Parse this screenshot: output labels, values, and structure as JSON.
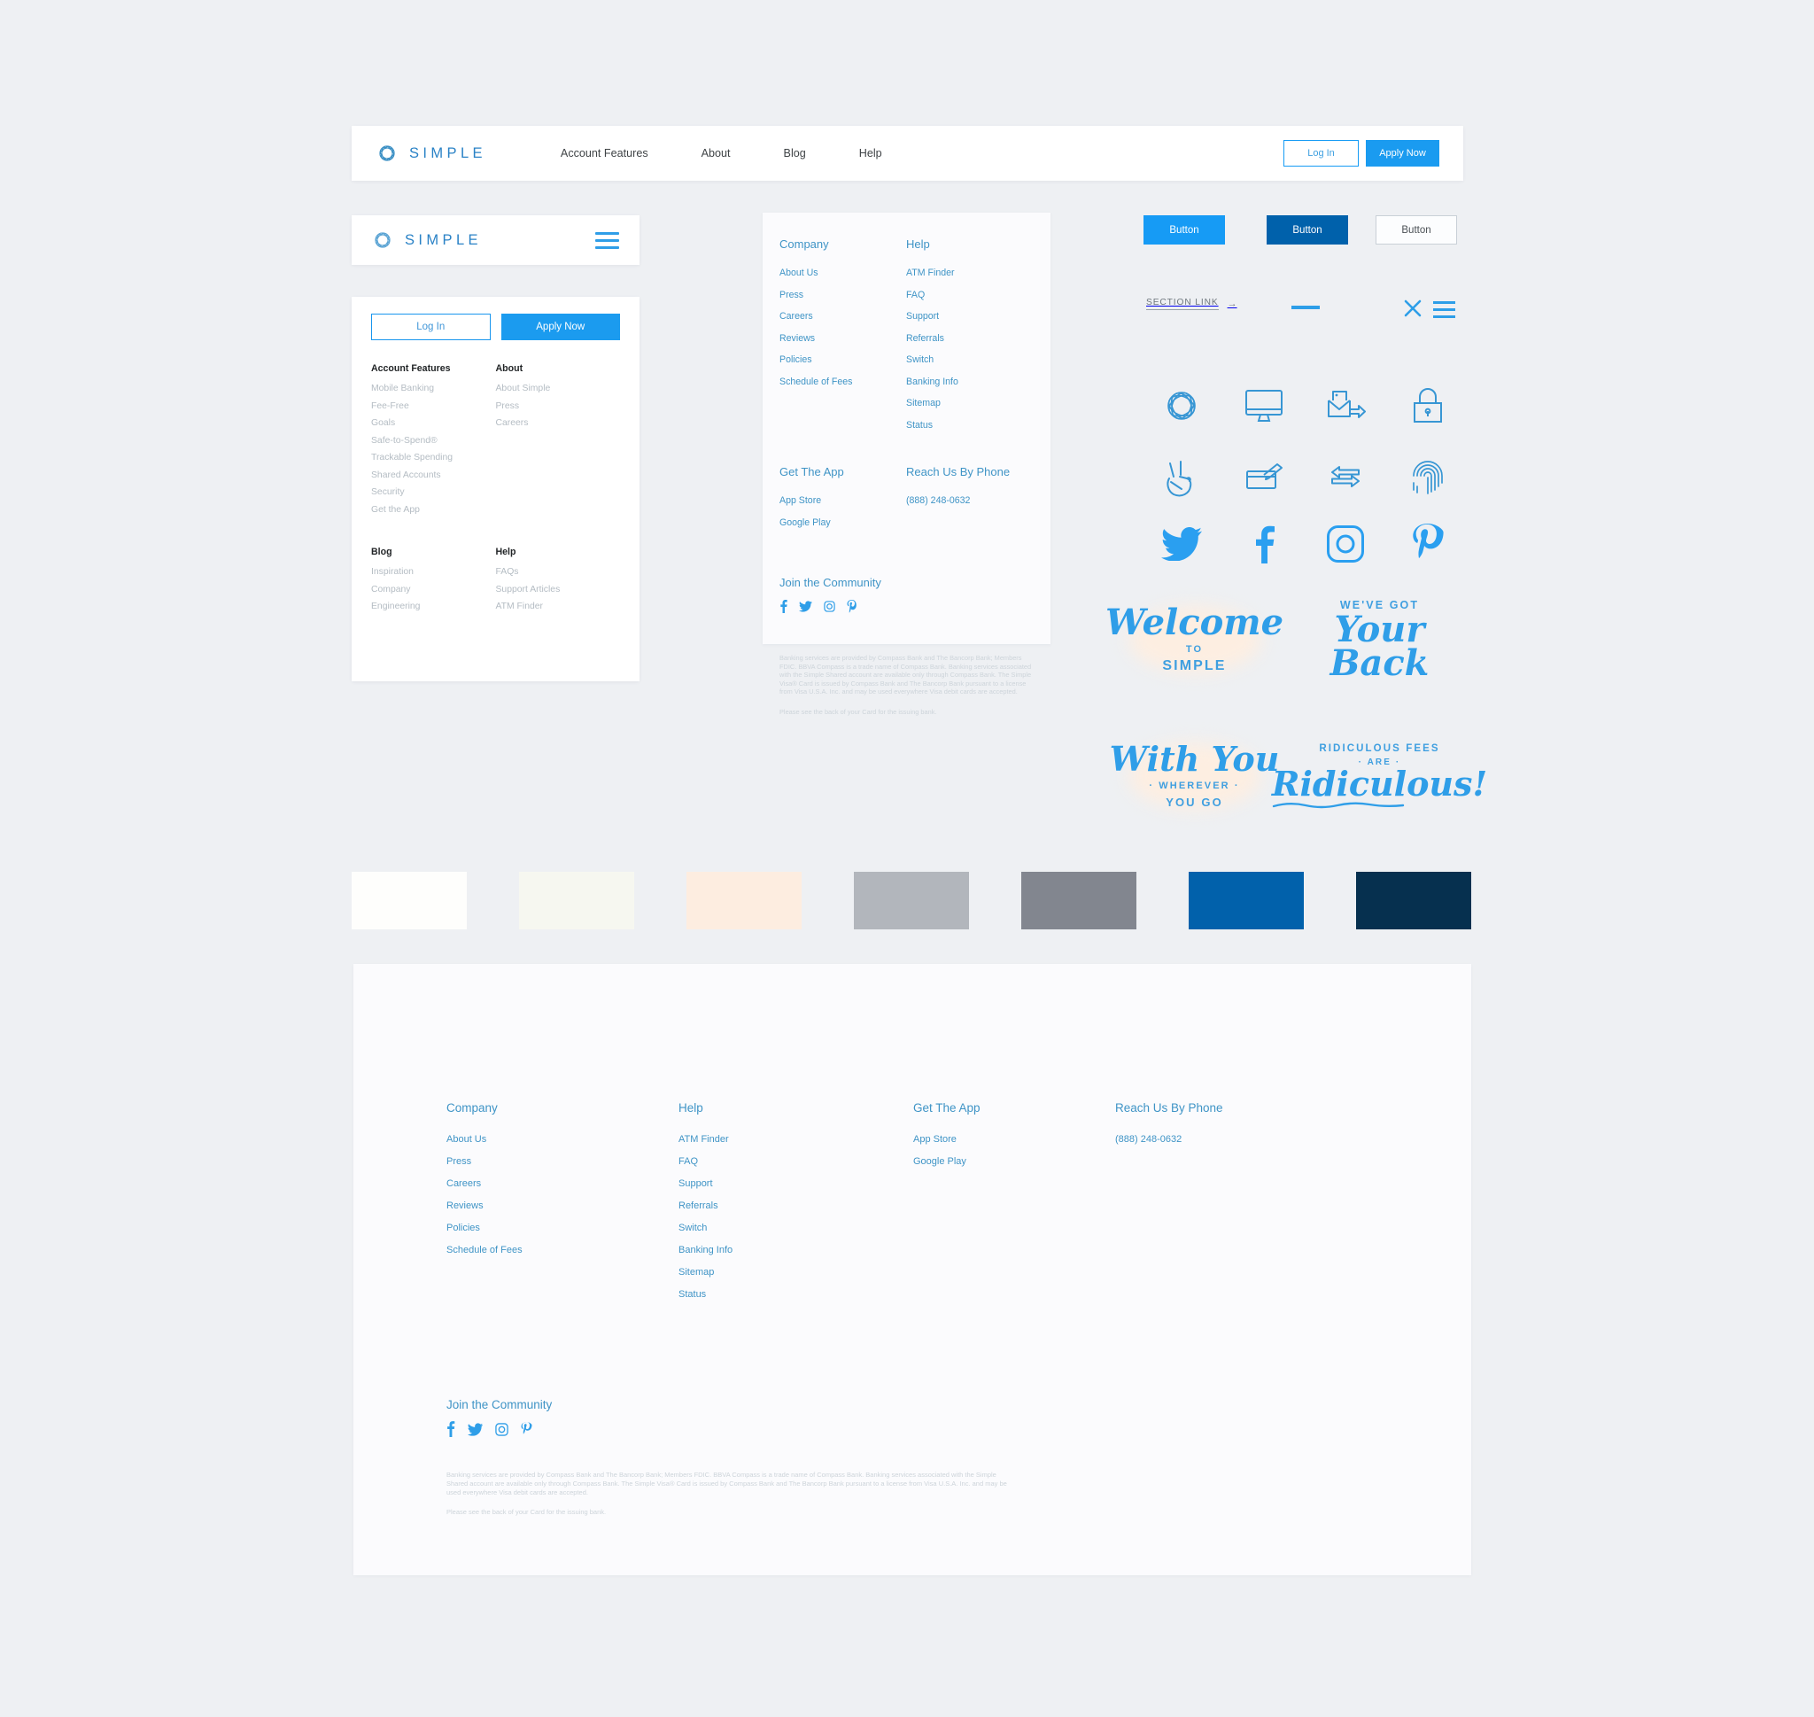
{
  "brand": {
    "name": "SIMPLE",
    "logo_icon": "simple-knot-logo-icon"
  },
  "topnav": {
    "links": [
      {
        "label": "Account Features"
      },
      {
        "label": "About"
      },
      {
        "label": "Blog"
      },
      {
        "label": "Help"
      }
    ],
    "login_label": "Log In",
    "apply_label": "Apply Now"
  },
  "mobile_menu": {
    "login_label": "Log In",
    "apply_label": "Apply Now",
    "menu_icon": "hamburger-icon",
    "columns_row1": [
      {
        "heading": "Account Features",
        "links": [
          "Mobile Banking",
          "Fee-Free",
          "Goals",
          "Safe-to-Spend®",
          "Trackable Spending",
          "Shared Accounts",
          "Security",
          "Get the App"
        ]
      },
      {
        "heading": "About",
        "links": [
          "About Simple",
          "Press",
          "Careers"
        ]
      }
    ],
    "columns_row2": [
      {
        "heading": "Blog",
        "links": [
          "Inspiration",
          "Company",
          "Engineering"
        ]
      },
      {
        "heading": "Help",
        "links": [
          "FAQs",
          "Support Articles",
          "ATM Finder"
        ]
      }
    ]
  },
  "footer_card": {
    "columns_row1": [
      {
        "heading": "Company",
        "links": [
          "About Us",
          "Press",
          "Careers",
          "Reviews",
          "Policies",
          "Schedule of Fees"
        ]
      },
      {
        "heading": "Help",
        "links": [
          "ATM Finder",
          "FAQ",
          "Support",
          "Referrals",
          "Switch",
          "Banking Info",
          "Sitemap",
          "Status"
        ]
      }
    ],
    "columns_row2": [
      {
        "heading": "Get The App",
        "links": [
          "App Store",
          "Google Play"
        ]
      },
      {
        "heading": "Reach Us By Phone",
        "links": [
          "(888) 248-0632"
        ]
      }
    ],
    "community_heading": "Join the Community",
    "social": [
      "facebook-icon",
      "twitter-icon",
      "instagram-icon",
      "pinterest-icon"
    ],
    "legal_1": "Banking services are provided by Compass Bank and The Bancorp Bank; Members FDIC. BBVA Compass is a trade name of Compass Bank. Banking services associated with the Simple Shared account are available only through Compass Bank. The Simple Visa® Card is issued by Compass Bank and The Bancorp Bank pursuant to a license from Visa U.S.A. Inc. and may be used everywhere Visa debit cards are accepted.",
    "legal_2": "Please see the back of your Card for the issuing bank."
  },
  "components": {
    "button_primary_label": "Button",
    "button_dark_label": "Button",
    "button_outline_label": "Button",
    "section_link_label": "SECTION LINK",
    "section_link_arrow": "→",
    "close_icon": "close-x-icon",
    "menu_icon": "hamburger-icon",
    "rule": "horizontal-rule-accent"
  },
  "icons": {
    "row1": [
      "simple-knot-logo-icon",
      "desktop-monitor-icon",
      "envelope-send-icon",
      "padlock-icon"
    ],
    "row2": [
      "peace-hand-icon",
      "card-swipe-icon",
      "transfer-arrows-icon",
      "fingerprint-icon"
    ],
    "row3": [
      "twitter-icon",
      "facebook-icon",
      "instagram-icon",
      "pinterest-icon"
    ]
  },
  "lettering": [
    {
      "script": "Welcome",
      "sub1": "TO",
      "sub2": "SIMPLE",
      "name": "welcome-to-simple-lettering"
    },
    {
      "top": "WE'VE GOT",
      "script": "Your Back",
      "name": "weve-got-your-back-lettering"
    },
    {
      "script": "With You",
      "sub1": "· WHEREVER ·",
      "sub2": "YOU GO",
      "name": "with-you-wherever-you-go-lettering"
    },
    {
      "top": "RIDICULOUS FEES",
      "mid": "· ARE ·",
      "script": "Ridiculous!",
      "name": "ridiculous-fees-are-ridiculous-lettering"
    }
  ],
  "palette": [
    {
      "name": "white",
      "hex": "#FEFEFC"
    },
    {
      "name": "off-white-green",
      "hex": "#F6F7F0"
    },
    {
      "name": "peach",
      "hex": "#FDEDE0"
    },
    {
      "name": "light-gray",
      "hex": "#B2B6BC"
    },
    {
      "name": "mid-gray",
      "hex": "#82868F"
    },
    {
      "name": "brand-blue",
      "hex": "#0161AB"
    },
    {
      "name": "navy",
      "hex": "#06304F"
    }
  ],
  "footer": {
    "columns": [
      {
        "heading": "Company",
        "links": [
          "About Us",
          "Press",
          "Careers",
          "Reviews",
          "Policies",
          "Schedule of Fees"
        ]
      },
      {
        "heading": "Help",
        "links": [
          "ATM Finder",
          "FAQ",
          "Support",
          "Referrals",
          "Switch",
          "Banking Info",
          "Sitemap",
          "Status"
        ]
      },
      {
        "heading": "Get The App",
        "links": [
          "App Store",
          "Google Play"
        ]
      },
      {
        "heading": "Reach Us By Phone",
        "links": [
          "(888) 248-0632"
        ]
      }
    ],
    "community_heading": "Join the Community",
    "social": [
      "facebook-icon",
      "twitter-icon",
      "instagram-icon",
      "pinterest-icon"
    ],
    "legal_1": "Banking services are provided by Compass Bank and The Bancorp Bank; Members FDIC. BBVA Compass is a trade name of Compass Bank. Banking services associated with the Simple Shared account are available only through Compass Bank. The Simple Visa® Card is issued by Compass Bank and The Bancorp Bank pursuant to a license from Visa U.S.A. Inc. and may be used everywhere Visa debit cards are accepted.",
    "legal_2": "Please see the back of your Card for the issuing bank."
  },
  "colors": {
    "accent_blue": "#1a9bf0",
    "link_blue": "#3f94c6",
    "dark_blue": "#0061ab",
    "page_bg": "#eef0f3"
  }
}
